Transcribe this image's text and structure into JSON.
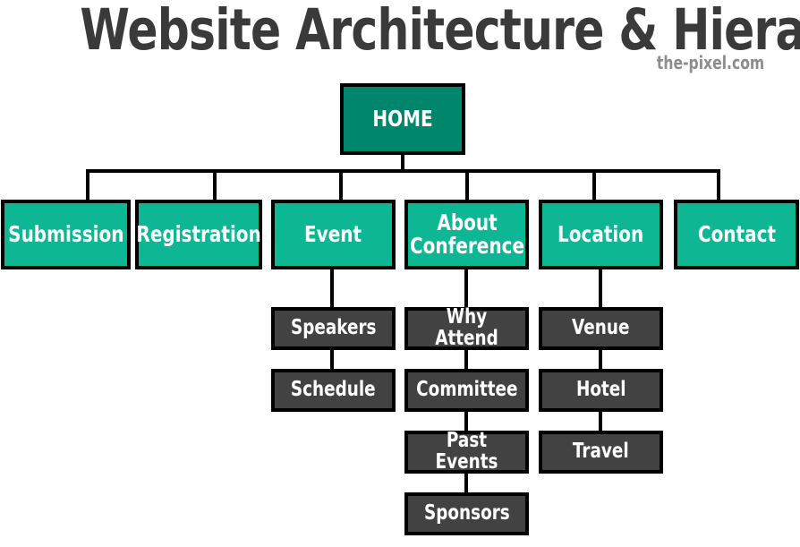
{
  "header": {
    "title": "Website Architecture & Hierarchy",
    "watermark": "the-pixel.com"
  },
  "colors": {
    "root_fill": "#00866b",
    "level2_fill": "#0db794",
    "level3_fill": "#424242",
    "border": "#000000",
    "text_on_box": "#ffffff",
    "title_text": "#3a3a3a",
    "watermark_text": "#8d8d8d",
    "background": "#ffffff"
  },
  "diagram": {
    "type": "site-map-tree",
    "root": {
      "label": "HOME"
    },
    "level2": [
      {
        "label": "Submission"
      },
      {
        "label": "Registration"
      },
      {
        "label": "Event"
      },
      {
        "label": "About\nConference"
      },
      {
        "label": "Location"
      },
      {
        "label": "Contact"
      }
    ],
    "level3": {
      "event": [
        {
          "label": "Speakers"
        },
        {
          "label": "Schedule"
        }
      ],
      "about_conference": [
        {
          "label": "Why Attend"
        },
        {
          "label": "Committee"
        },
        {
          "label": "Past Events"
        },
        {
          "label": "Sponsors"
        }
      ],
      "location": [
        {
          "label": "Venue"
        },
        {
          "label": "Hotel"
        },
        {
          "label": "Travel"
        }
      ]
    }
  }
}
